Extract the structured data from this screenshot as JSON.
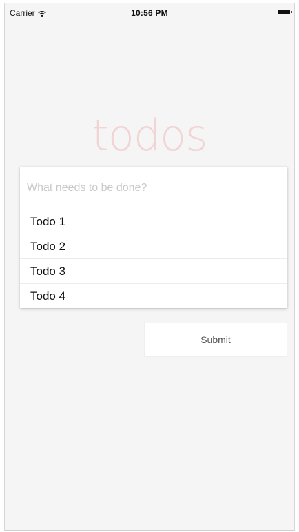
{
  "status_bar": {
    "carrier": "Carrier",
    "time": "10:56 PM"
  },
  "app": {
    "title": "todos"
  },
  "new_todo": {
    "placeholder": "What needs to be done?",
    "value": ""
  },
  "todos": [
    {
      "label": "Todo 1"
    },
    {
      "label": "Todo 2"
    },
    {
      "label": "Todo 3"
    },
    {
      "label": "Todo 4"
    }
  ],
  "submit": {
    "label": "Submit"
  },
  "colors": {
    "background": "#f5f5f5",
    "title": "#f1d4d4",
    "card": "#ffffff",
    "placeholder": "#c9c9c9"
  }
}
